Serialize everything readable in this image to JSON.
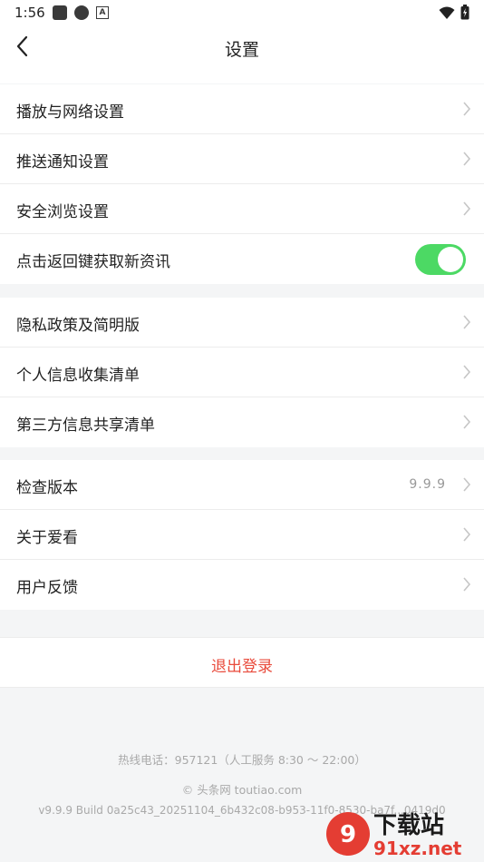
{
  "status_bar": {
    "time": "1:56"
  },
  "header": {
    "title": "设置"
  },
  "groups": [
    {
      "items": [
        {
          "label": "播放与网络设置"
        },
        {
          "label": "推送通知设置"
        },
        {
          "label": "安全浏览设置"
        },
        {
          "label": "点击返回键获取新资讯",
          "toggle": "on"
        }
      ]
    },
    {
      "items": [
        {
          "label": "隐私政策及简明版"
        },
        {
          "label": "个人信息收集清单"
        },
        {
          "label": "第三方信息共享清单"
        }
      ]
    },
    {
      "items": [
        {
          "label": "检查版本",
          "value": "9.9.9"
        },
        {
          "label": "关于爱看"
        },
        {
          "label": "用户反馈"
        }
      ]
    }
  ],
  "logout": {
    "label": "退出登录"
  },
  "footer": {
    "hotline": "热线电话：957121（人工服务 8:30 ～ 22:00）",
    "copyright": "© 头条网 toutiao.com",
    "build": "v9.9.9 Build 0a25c43_20251104_6b432c08-b953-11f0-8530-ba7f...0419d0"
  },
  "watermark": {
    "brand": "下载站",
    "site": "91xz.net"
  },
  "colors": {
    "accent_red": "#e94b3c",
    "toggle_green": "#4cd964"
  }
}
